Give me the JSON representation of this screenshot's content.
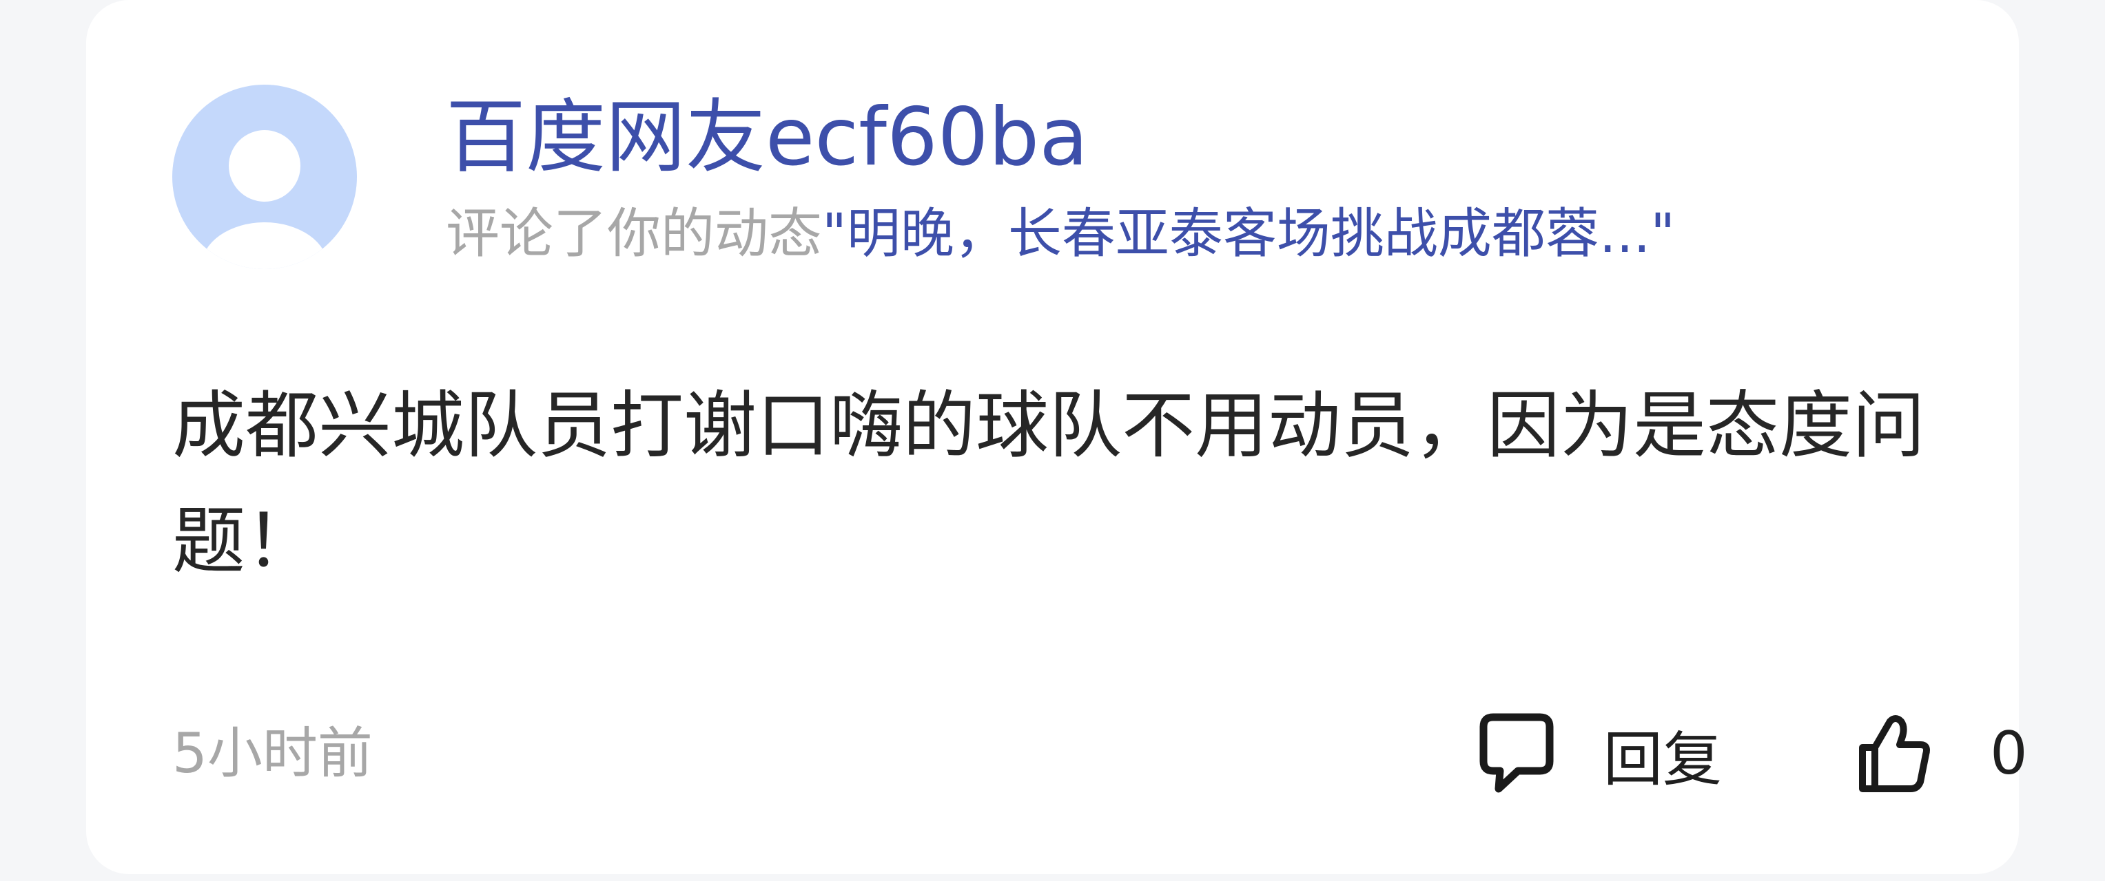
{
  "user": {
    "name": "百度网友ecf60ba",
    "avatar_icon": "default-user-avatar-icon"
  },
  "activity": {
    "prefix": "评论了你的动态",
    "post_excerpt": "\"明晚，长春亚泰客场挑战成都蓉...\""
  },
  "comment": {
    "text": "成都兴城队员打谢口嗨的球队不用动员，因为是态度问题！"
  },
  "meta": {
    "timestamp": "5小时前"
  },
  "actions": {
    "reply_label": "回复",
    "reply_icon": "speech-bubble-icon",
    "like_icon": "thumbs-up-icon",
    "like_count": "0"
  },
  "colors": {
    "link_blue": "#3d4faa",
    "secondary_gray": "#a7a7a7",
    "avatar_bg": "#c4d8fb",
    "page_bg": "#f5f6f8"
  }
}
